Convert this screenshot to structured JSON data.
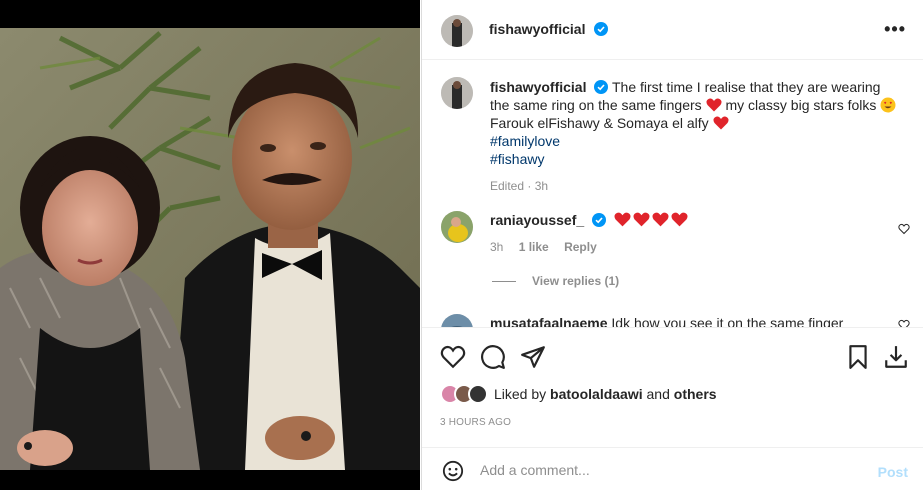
{
  "post_header": {
    "username": "fishawyofficial",
    "more_icon": "more-options-icon"
  },
  "caption": {
    "username": "fishawyofficial",
    "text_1": "The first time I realise that they are wearing the same ring on the same fingers",
    "text_2": "my classy big stars folks",
    "text_3": "Farouk elFishawy & Somaya el alfy",
    "hashtags": [
      "#familylove",
      "#fishawy"
    ],
    "meta": "Edited · 3h"
  },
  "comments": [
    {
      "username": "raniayoussef_",
      "verified": true,
      "time": "3h",
      "likes": "1 like",
      "reply_label": "Reply",
      "view_replies": "View replies (1)"
    },
    {
      "username": "musatafaalnaeme",
      "text": "Idk how you see it on the same finger"
    }
  ],
  "actions": {
    "liked_by_prefix": "Liked by",
    "liked_by_user": "batoolaldaawi",
    "liked_by_and": "and",
    "liked_by_others": "others",
    "timestamp": "3 HOURS AGO"
  },
  "comment_input": {
    "placeholder": "Add a comment...",
    "post_label": "Post"
  },
  "colors": {
    "verified": "#0095f6",
    "heart": "#ed4956",
    "link": "#00376b",
    "muted": "#8e8e8e",
    "post_disabled": "#b2dffc"
  }
}
